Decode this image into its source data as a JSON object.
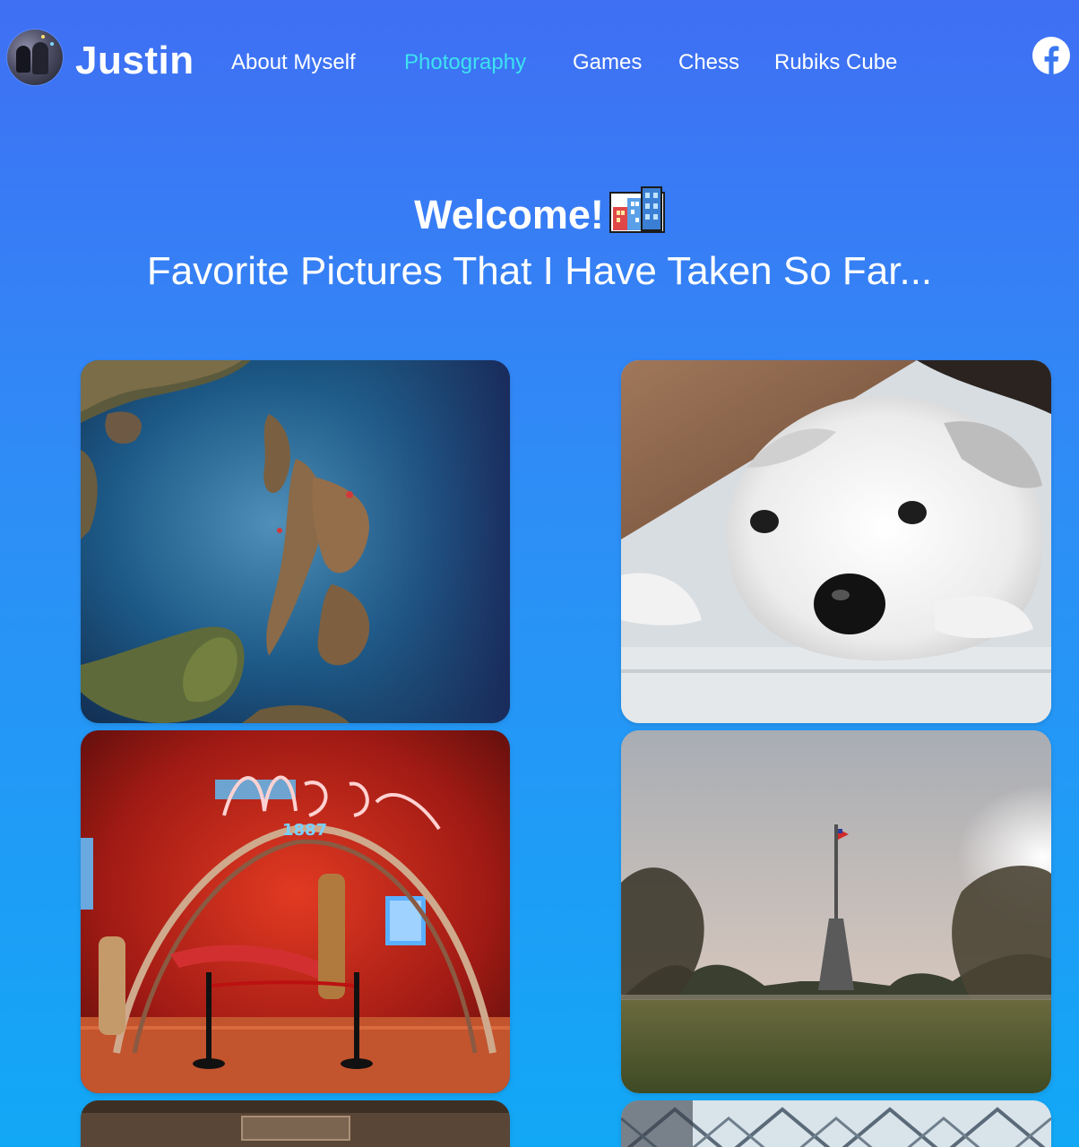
{
  "site": {
    "brand": "Justin"
  },
  "nav": {
    "links": [
      "About Myself",
      "Photography",
      "Games",
      "Chess",
      "Rubiks Cube"
    ],
    "active": "Photography",
    "social": "facebook-icon"
  },
  "hero": {
    "welcome": "Welcome!",
    "welcome_emoji": "city-buildings-icon",
    "subtitle": "Favorite Pictures That I Have Taken So Far..."
  },
  "gallery": {
    "photos": [
      "photo-relief-map",
      "photo-puppy",
      "photo-neon-museum-exhibit",
      "photo-flagpole-park",
      "photo-wooden-sign",
      "photo-lattice-ceiling"
    ]
  },
  "colors": {
    "background_top": "#3f6ff4",
    "background_bottom": "#12a8f6",
    "active_link": "#3de2f0",
    "text": "#ffffff"
  }
}
